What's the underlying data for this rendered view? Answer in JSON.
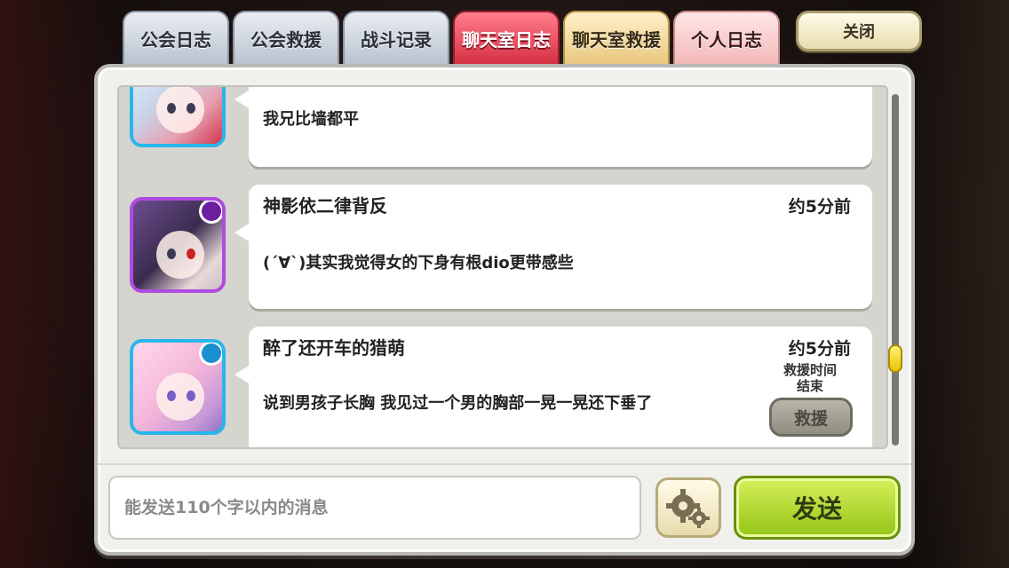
{
  "tabs": [
    {
      "label": "公会日志",
      "active": false
    },
    {
      "label": "公会救援",
      "active": false
    },
    {
      "label": "战斗记录",
      "active": false
    },
    {
      "label": "聊天室日志",
      "active": true
    },
    {
      "label": "聊天室救援",
      "active": false
    },
    {
      "label": "个人日志",
      "active": false
    }
  ],
  "close_label": "关闭",
  "messages": [
    {
      "name": "",
      "time": "",
      "text": "我兄比墙都平",
      "avatar_icon": "blue-hair-character-avatar"
    },
    {
      "name": "神影依二律背反",
      "time": "约5分前",
      "text": "(´∀`)其实我觉得女的下身有根dio更带感些",
      "avatar_icon": "purple-hair-character-avatar"
    },
    {
      "name": "醉了还开车的猎萌",
      "time": "约5分前",
      "text": "说到男孩子长胸 我见过一个男的胸部一晃一晃还下垂了",
      "avatar_icon": "pink-hair-character-avatar",
      "rescue_status_line1": "救援时间",
      "rescue_status_line2": "结束",
      "rescue_label": "救援"
    }
  ],
  "input": {
    "placeholder": "能发送110个字以内的消息",
    "value": ""
  },
  "send_label": "发送",
  "colors": {
    "active_tab": "#d63044",
    "send_button": "#94c416",
    "scroll_thumb": "#e8c400"
  }
}
